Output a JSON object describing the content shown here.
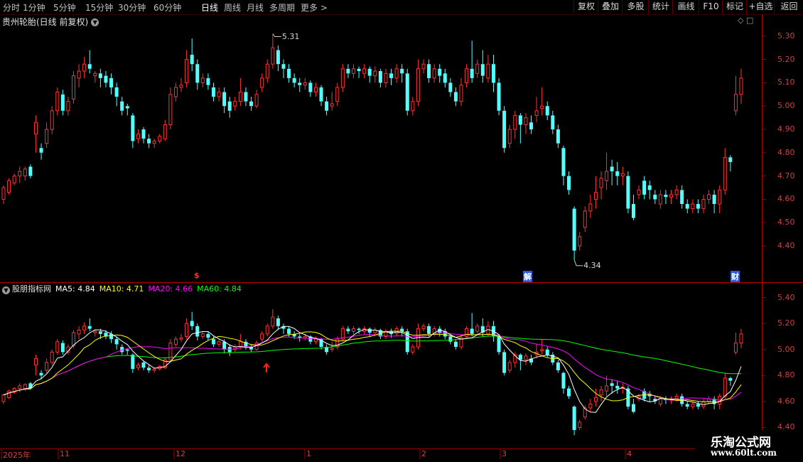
{
  "toolbar": {
    "periods": [
      "分时",
      "1分钟",
      "5分钟",
      "15分钟",
      "30分钟",
      "60分钟",
      "日线",
      "周线",
      "月线",
      "多周期",
      "更多 >"
    ],
    "active_period": "日线",
    "buttons": [
      "复权",
      "叠加",
      "多股",
      "统计",
      "画线",
      "F10",
      "标记",
      "+自选",
      "返回"
    ]
  },
  "main_chart": {
    "title": "贵州轮胎(日线 前复权)",
    "y_ticks": [
      "5.30",
      "5.20",
      "5.10",
      "5.00",
      "4.90",
      "4.80",
      "4.70",
      "4.60",
      "4.50",
      "4.40"
    ],
    "max_label": "5.31",
    "min_label": "4.34",
    "event_markers": [
      "$",
      "解",
      "财"
    ]
  },
  "sub_chart": {
    "title": "股朋指标网",
    "ma_labels": [
      {
        "text": "MA5: 4.84",
        "color": "#ffffff"
      },
      {
        "text": "MA10: 4.71",
        "color": "#ffff00"
      },
      {
        "text": "MA20: 4.66",
        "color": "#ff00ff"
      },
      {
        "text": "MA60: 4.84",
        "color": "#00ff00"
      }
    ],
    "y_ticks": [
      "5.40",
      "5.20",
      "5.00",
      "4.80",
      "4.60",
      "4.40"
    ]
  },
  "date_axis": [
    "2025年",
    "11",
    "12",
    "1",
    "2",
    "3",
    "4"
  ],
  "watermark": {
    "line1": "乐淘公式网",
    "line2": "www.60lt.com"
  },
  "colors": {
    "up": "#ff3232",
    "down": "#54ffff",
    "axis": "#a00000",
    "ma5": "#ffffff",
    "ma10": "#ffff00",
    "ma20": "#ff00ff",
    "ma60": "#00ff00"
  },
  "chart_data": {
    "type": "candlestick",
    "ylim_main": [
      4.33,
      5.33
    ],
    "ylim_sub": [
      4.38,
      5.42
    ],
    "candles": [
      [
        4.6,
        4.65,
        4.58,
        4.66
      ],
      [
        4.63,
        4.68,
        4.62,
        4.69
      ],
      [
        4.67,
        4.7,
        4.66,
        4.71
      ],
      [
        4.7,
        4.72,
        4.67,
        4.74
      ],
      [
        4.7,
        4.73,
        4.68,
        4.74
      ],
      [
        4.74,
        4.7,
        4.69,
        4.75
      ],
      [
        4.88,
        4.93,
        4.8,
        4.96
      ],
      [
        4.82,
        4.8,
        4.77,
        4.84
      ],
      [
        4.84,
        4.9,
        4.82,
        4.93
      ],
      [
        4.9,
        4.98,
        4.88,
        5.0
      ],
      [
        4.98,
        5.06,
        4.96,
        5.08
      ],
      [
        5.05,
        4.98,
        4.96,
        5.07
      ],
      [
        4.98,
        5.02,
        4.96,
        5.04
      ],
      [
        5.03,
        5.13,
        5.01,
        5.15
      ],
      [
        5.12,
        5.15,
        5.08,
        5.18
      ],
      [
        5.15,
        5.18,
        5.12,
        5.21
      ],
      [
        5.18,
        5.16,
        5.14,
        5.24
      ],
      [
        5.13,
        5.14,
        5.1,
        5.15
      ],
      [
        5.14,
        5.12,
        5.08,
        5.16
      ],
      [
        5.13,
        5.1,
        5.08,
        5.15
      ],
      [
        5.12,
        5.08,
        5.05,
        5.14
      ],
      [
        5.08,
        5.04,
        5.0,
        5.1
      ],
      [
        5.02,
        4.98,
        4.96,
        5.04
      ],
      [
        5.0,
        4.99,
        4.96,
        5.01
      ],
      [
        4.96,
        4.85,
        4.82,
        4.97
      ],
      [
        4.86,
        4.88,
        4.84,
        4.9
      ],
      [
        4.9,
        4.86,
        4.84,
        4.91
      ],
      [
        4.86,
        4.84,
        4.82,
        4.88
      ],
      [
        4.84,
        4.85,
        4.82,
        4.86
      ],
      [
        4.85,
        4.87,
        4.84,
        4.88
      ],
      [
        4.86,
        4.92,
        4.85,
        4.94
      ],
      [
        4.92,
        5.05,
        4.9,
        5.08
      ],
      [
        5.04,
        5.08,
        5.02,
        5.1
      ],
      [
        5.08,
        5.09,
        5.06,
        5.12
      ],
      [
        5.1,
        5.2,
        5.08,
        5.24
      ],
      [
        5.22,
        5.18,
        5.15,
        5.29
      ],
      [
        5.18,
        5.1,
        5.07,
        5.2
      ],
      [
        5.1,
        5.12,
        5.08,
        5.14
      ],
      [
        5.12,
        5.09,
        5.07,
        5.14
      ],
      [
        5.08,
        5.04,
        5.02,
        5.1
      ],
      [
        5.04,
        5.06,
        5.02,
        5.08
      ],
      [
        5.06,
        5.0,
        4.97,
        5.08
      ],
      [
        5.02,
        4.98,
        4.95,
        5.04
      ],
      [
        5.0,
        5.02,
        4.98,
        5.04
      ],
      [
        5.02,
        5.06,
        5.0,
        5.12
      ],
      [
        5.06,
        5.02,
        5.0,
        5.08
      ],
      [
        5.02,
        5.0,
        4.98,
        5.04
      ],
      [
        5.0,
        5.05,
        4.99,
        5.07
      ],
      [
        5.08,
        5.12,
        5.06,
        5.14
      ],
      [
        5.12,
        5.18,
        5.1,
        5.2
      ],
      [
        5.18,
        5.25,
        5.16,
        5.31
      ],
      [
        5.24,
        5.18,
        5.15,
        5.26
      ],
      [
        5.18,
        5.16,
        5.12,
        5.2
      ],
      [
        5.16,
        5.12,
        5.1,
        5.18
      ],
      [
        5.12,
        5.1,
        5.08,
        5.14
      ],
      [
        5.1,
        5.09,
        5.06,
        5.12
      ],
      [
        5.09,
        5.1,
        5.07,
        5.12
      ],
      [
        5.1,
        5.06,
        5.04,
        5.11
      ],
      [
        5.06,
        5.08,
        5.04,
        5.1
      ],
      [
        5.08,
        5.02,
        5.0,
        5.09
      ],
      [
        5.02,
        4.98,
        4.96,
        5.04
      ],
      [
        5.0,
        5.01,
        4.98,
        5.06
      ],
      [
        5.02,
        5.08,
        5.0,
        5.1
      ],
      [
        5.08,
        5.16,
        5.06,
        5.18
      ],
      [
        5.16,
        5.14,
        5.12,
        5.18
      ],
      [
        5.14,
        5.16,
        5.12,
        5.18
      ],
      [
        5.16,
        5.15,
        5.12,
        5.17
      ],
      [
        5.14,
        5.16,
        5.12,
        5.18
      ],
      [
        5.16,
        5.13,
        5.1,
        5.17
      ],
      [
        5.13,
        5.15,
        5.1,
        5.17
      ],
      [
        5.15,
        5.1,
        5.08,
        5.16
      ],
      [
        5.1,
        5.14,
        5.08,
        5.16
      ],
      [
        5.14,
        5.12,
        5.09,
        5.16
      ],
      [
        5.12,
        5.16,
        5.1,
        5.18
      ],
      [
        5.16,
        5.14,
        5.1,
        5.18
      ],
      [
        5.14,
        4.98,
        4.96,
        5.16
      ],
      [
        4.98,
        5.02,
        4.96,
        5.04
      ],
      [
        5.02,
        5.16,
        5.0,
        5.2
      ],
      [
        5.16,
        5.18,
        5.14,
        5.2
      ],
      [
        5.18,
        5.12,
        5.1,
        5.2
      ],
      [
        5.12,
        5.16,
        5.1,
        5.18
      ],
      [
        5.16,
        5.13,
        5.1,
        5.18
      ],
      [
        5.14,
        5.1,
        5.08,
        5.16
      ],
      [
        5.1,
        5.06,
        5.04,
        5.12
      ],
      [
        5.06,
        5.02,
        5.0,
        5.08
      ],
      [
        5.02,
        5.09,
        5.0,
        5.12
      ],
      [
        5.1,
        5.16,
        5.08,
        5.18
      ],
      [
        5.16,
        5.12,
        5.1,
        5.28
      ],
      [
        5.14,
        5.18,
        5.12,
        5.2
      ],
      [
        5.18,
        5.13,
        5.1,
        5.24
      ],
      [
        5.12,
        5.18,
        5.1,
        5.22
      ],
      [
        5.18,
        5.1,
        5.06,
        5.22
      ],
      [
        5.1,
        4.98,
        4.96,
        5.12
      ],
      [
        4.98,
        4.82,
        4.8,
        5.0
      ],
      [
        4.84,
        4.9,
        4.82,
        4.92
      ],
      [
        4.9,
        4.96,
        4.86,
        4.98
      ],
      [
        4.96,
        4.92,
        4.84,
        4.97
      ],
      [
        4.92,
        4.95,
        4.88,
        4.97
      ],
      [
        4.93,
        4.9,
        4.88,
        4.96
      ],
      [
        4.96,
        4.98,
        4.93,
        5.04
      ],
      [
        4.99,
        5.0,
        4.96,
        5.08
      ],
      [
        5.0,
        4.96,
        4.94,
        5.02
      ],
      [
        4.96,
        4.9,
        4.88,
        4.98
      ],
      [
        4.9,
        4.84,
        4.82,
        4.92
      ],
      [
        4.82,
        4.7,
        4.66,
        4.83
      ],
      [
        4.7,
        4.64,
        4.62,
        4.72
      ],
      [
        4.56,
        4.38,
        4.34,
        4.57
      ],
      [
        4.4,
        4.44,
        4.38,
        4.46
      ],
      [
        4.48,
        4.55,
        4.46,
        4.57
      ],
      [
        4.55,
        4.58,
        4.52,
        4.62
      ],
      [
        4.6,
        4.63,
        4.56,
        4.7
      ],
      [
        4.65,
        4.69,
        4.6,
        4.72
      ],
      [
        4.68,
        4.72,
        4.64,
        4.8
      ],
      [
        4.74,
        4.72,
        4.66,
        4.77
      ],
      [
        4.72,
        4.7,
        4.66,
        4.76
      ],
      [
        4.7,
        4.71,
        4.66,
        4.74
      ],
      [
        4.7,
        4.56,
        4.54,
        4.72
      ],
      [
        4.58,
        4.52,
        4.51,
        4.62
      ],
      [
        4.62,
        4.64,
        4.6,
        4.66
      ],
      [
        4.68,
        4.62,
        4.6,
        4.7
      ],
      [
        4.66,
        4.64,
        4.6,
        4.68
      ],
      [
        4.62,
        4.6,
        4.58,
        4.64
      ],
      [
        4.58,
        4.62,
        4.56,
        4.64
      ],
      [
        4.62,
        4.61,
        4.58,
        4.64
      ],
      [
        4.61,
        4.62,
        4.58,
        4.64
      ],
      [
        4.62,
        4.64,
        4.6,
        4.66
      ],
      [
        4.64,
        4.58,
        4.56,
        4.66
      ],
      [
        4.58,
        4.56,
        4.54,
        4.6
      ],
      [
        4.56,
        4.58,
        4.54,
        4.6
      ],
      [
        4.58,
        4.56,
        4.54,
        4.6
      ],
      [
        4.56,
        4.6,
        4.54,
        4.62
      ],
      [
        4.6,
        4.62,
        4.58,
        4.64
      ],
      [
        4.62,
        4.58,
        4.54,
        4.64
      ],
      [
        4.58,
        4.64,
        4.54,
        4.66
      ],
      [
        4.64,
        4.78,
        4.62,
        4.82
      ],
      [
        4.78,
        4.76,
        4.72,
        4.79
      ],
      [
        4.98,
        5.05,
        4.96,
        5.13
      ],
      [
        5.05,
        5.12,
        5.01,
        5.16
      ]
    ],
    "ma5_end": 4.84,
    "ma10_end": 4.71,
    "ma20_end": 4.66,
    "ma60_end": 4.84
  }
}
